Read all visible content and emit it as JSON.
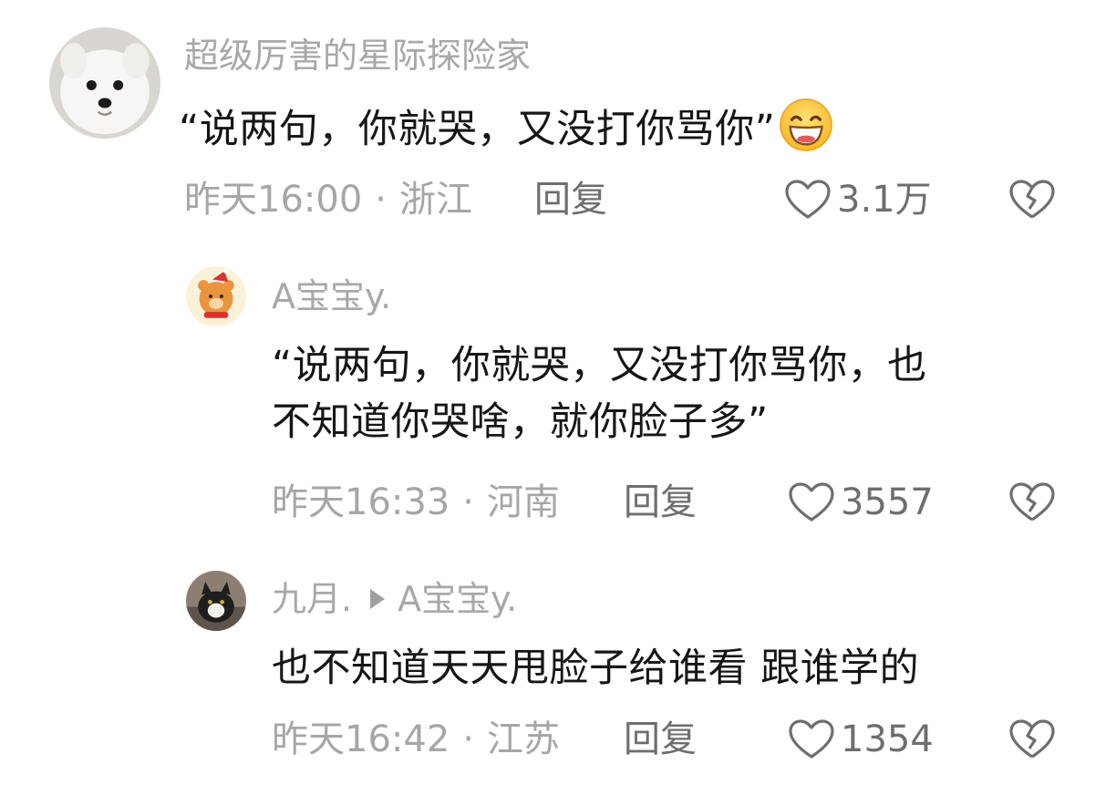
{
  "comments": [
    {
      "username": "超级厉害的星际探险家",
      "text": "“说两句，你就哭，又没打你骂你”",
      "emoji": "grinning-sweat-emoji",
      "time": "昨天16:00",
      "location": "浙江",
      "reply_label": "回复",
      "likes": "3.1万"
    },
    {
      "username": "A宝宝y.",
      "text_line1": "“说两句，你就哭，又没打你骂你，也",
      "text_line2": "不知道你哭啥，就你脸子多”",
      "time": "昨天16:33",
      "location": "河南",
      "reply_label": "回复",
      "likes": "3557"
    },
    {
      "username": "九月.",
      "reply_to": "A宝宝y.",
      "text": "也不知道天天甩脸子给谁看 跟谁学的",
      "time": "昨天16:42",
      "location": "江苏",
      "reply_label": "回复",
      "likes": "1354"
    }
  ],
  "meta_separator": "·",
  "colors": {
    "meta_gray": "#a6a6a6",
    "action_gray": "#6e6e6e",
    "text_dark": "#161616"
  }
}
